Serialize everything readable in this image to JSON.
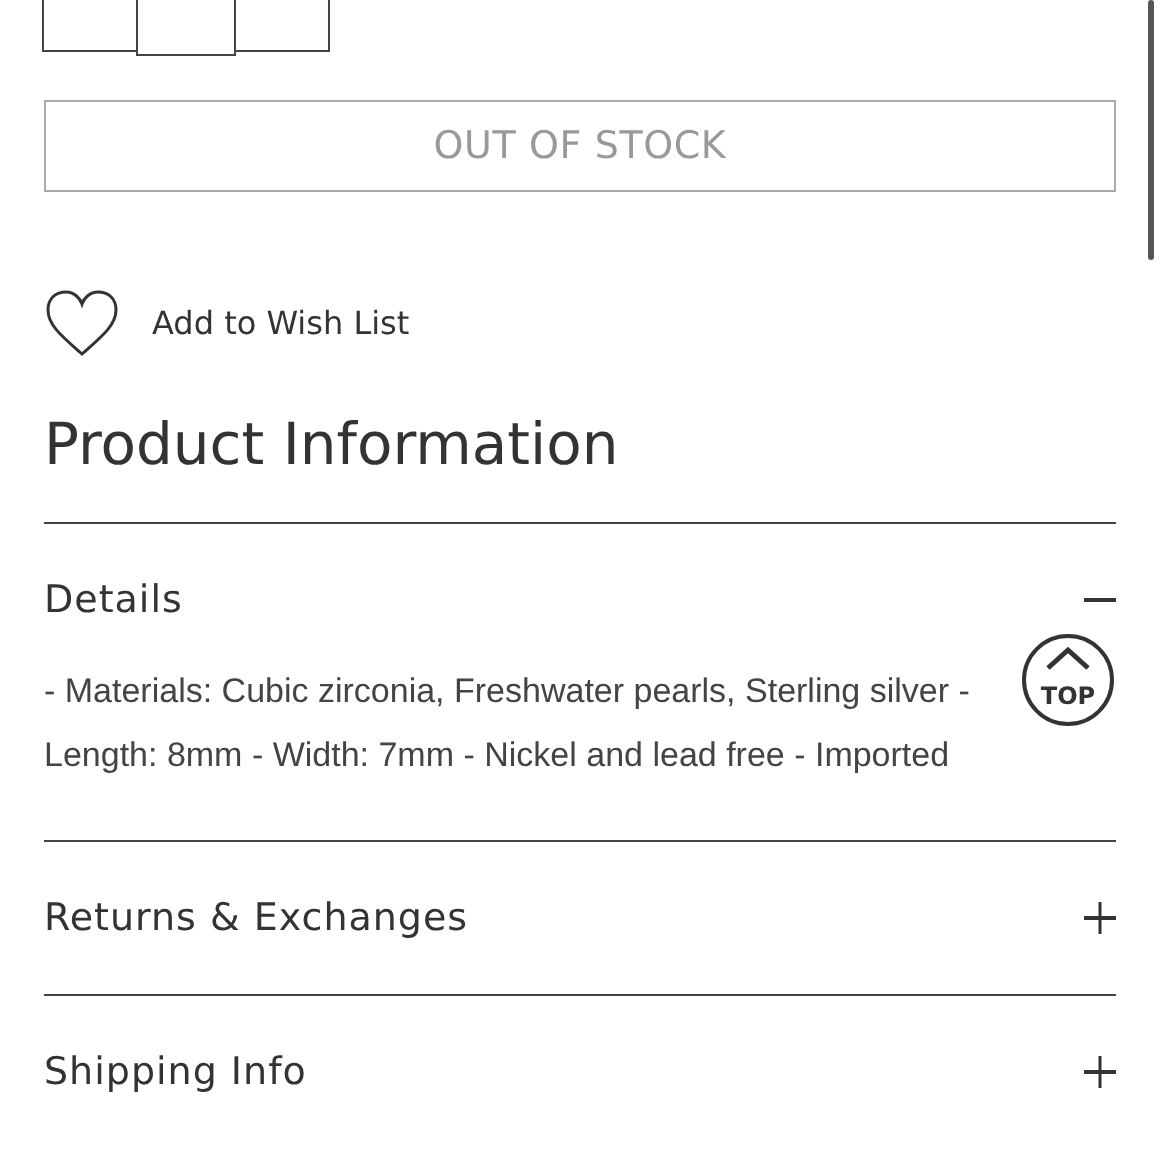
{
  "stock_button": {
    "label": "OUT OF STOCK",
    "disabled": true
  },
  "wish_list": {
    "label": "Add to Wish List"
  },
  "section_title": "Product Information",
  "accordion": [
    {
      "title": "Details",
      "expanded": true,
      "body": "- Materials: Cubic zirconia, Freshwater pearls, Sterling silver - Length: 8mm - Width: 7mm - Nickel and lead free - Imported"
    },
    {
      "title": "Returns & Exchanges",
      "expanded": false
    },
    {
      "title": "Shipping Info",
      "expanded": false
    }
  ],
  "top_button": {
    "label": "TOP"
  }
}
